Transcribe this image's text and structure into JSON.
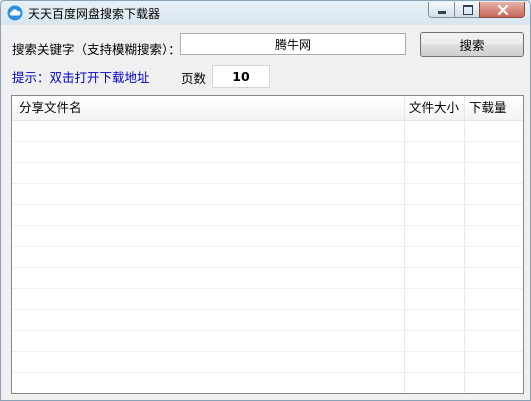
{
  "window": {
    "title": "天天百度网盘搜索下载器",
    "icon": "cloud-icon",
    "controls": [
      "minimize-button",
      "maximize-button",
      "close-button"
    ]
  },
  "search": {
    "label": "搜索关键字（支持模糊搜索）：",
    "value": "腾牛网",
    "button_label": "搜索"
  },
  "hint": {
    "text": "提示：双击打开下载地址"
  },
  "pages": {
    "label": "页数",
    "value": "10"
  },
  "results": {
    "columns": [
      "分享文件名",
      "文件大小",
      "下载量"
    ],
    "rows": []
  }
}
